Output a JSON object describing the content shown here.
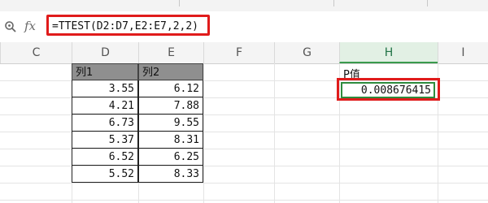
{
  "formula_bar": {
    "zoom_icon": "zoom-icon",
    "fx_label": "fx",
    "formula": "=TTEST(D2:D7,E2:E7,2,2)"
  },
  "columns": [
    "C",
    "D",
    "E",
    "F",
    "G",
    "H",
    "I"
  ],
  "active_column": "H",
  "table": {
    "headers": [
      "列1",
      "列2"
    ],
    "rows": [
      [
        "3.55",
        "6.12"
      ],
      [
        "4.21",
        "7.88"
      ],
      [
        "6.73",
        "9.55"
      ],
      [
        "5.37",
        "8.31"
      ],
      [
        "6.52",
        "6.25"
      ],
      [
        "5.52",
        "8.33"
      ]
    ]
  },
  "result": {
    "label": "P值",
    "value": "0.008676415"
  },
  "colors": {
    "highlight_border": "#e01b1b",
    "selection_green": "#2e8b3d",
    "header_fill": "#8f8f8f"
  }
}
